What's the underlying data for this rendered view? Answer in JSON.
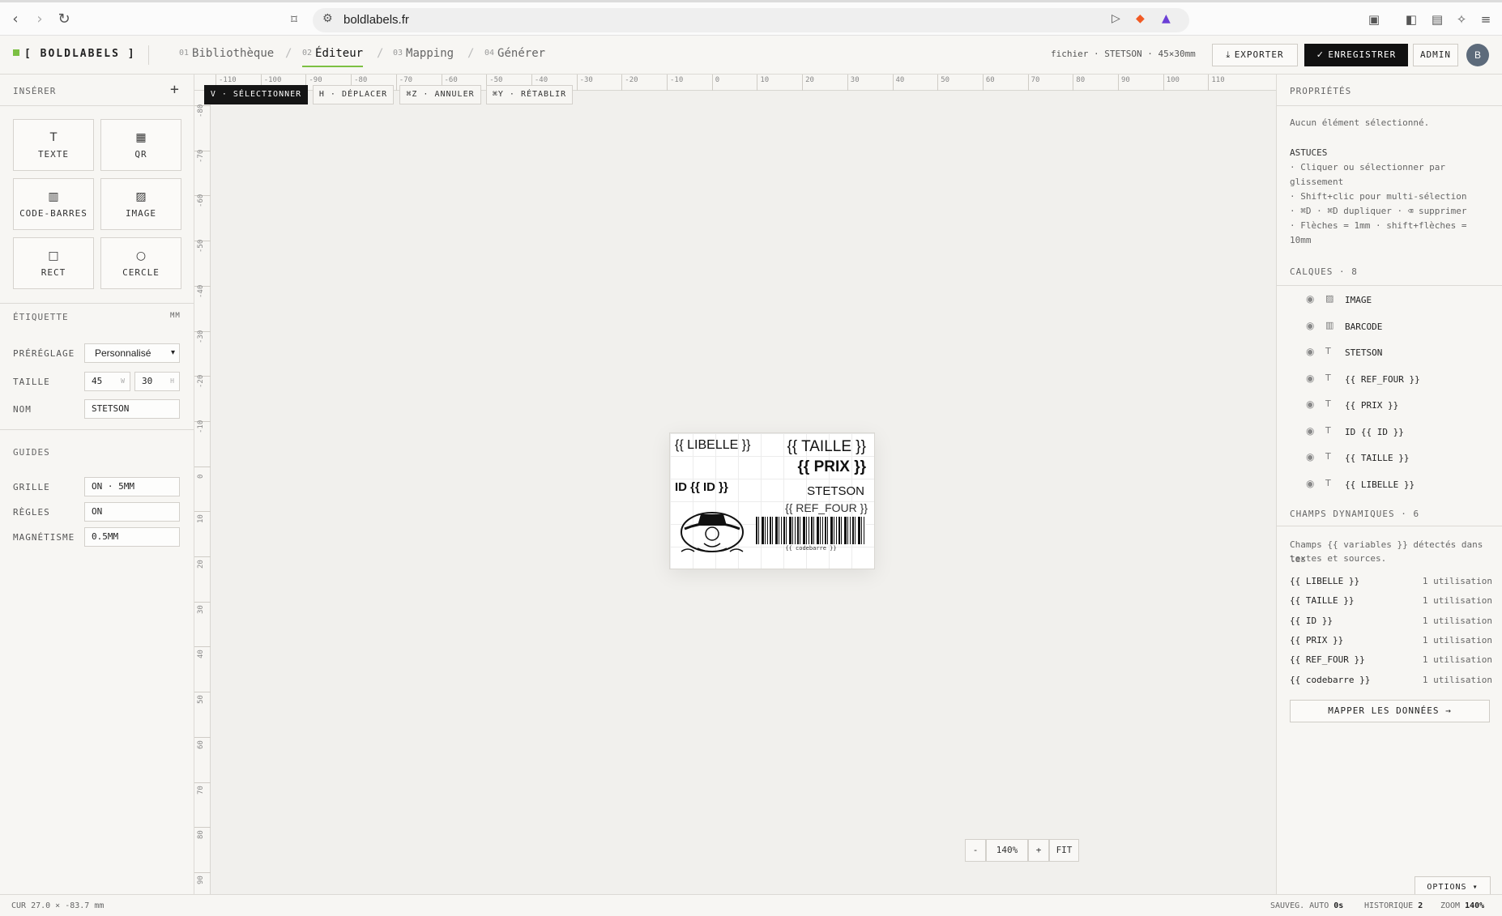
{
  "browser": {
    "url": "boldlabels.fr"
  },
  "header": {
    "brand": "[ BOLDLABELS ]",
    "steps": [
      {
        "num": "01",
        "label": "Bibliothèque"
      },
      {
        "num": "02",
        "label": "Éditeur"
      },
      {
        "num": "03",
        "label": "Mapping"
      },
      {
        "num": "04",
        "label": "Générer"
      }
    ],
    "file_info": "fichier · STETSON · 45×30mm",
    "export_label": "EXPORTER",
    "save_label": "ENREGISTRER",
    "admin_label": "ADMIN",
    "avatar_initial": "B"
  },
  "left": {
    "insert_title": "INSÉRER",
    "add_symbol": "+",
    "tools": [
      {
        "label": "TEXTE",
        "icon": "text-icon"
      },
      {
        "label": "QR",
        "icon": "qr-icon"
      },
      {
        "label": "CODE-BARRES",
        "icon": "barcode-icon"
      },
      {
        "label": "IMAGE",
        "icon": "image-icon"
      },
      {
        "label": "RECT",
        "icon": "rect-icon"
      },
      {
        "label": "CERCLE",
        "icon": "circle-icon"
      }
    ],
    "label_title": "ÉTIQUETTE",
    "label_unit": "MM",
    "preset_label": "PRÉRÉGLAGE",
    "preset_value": "Personnalisé",
    "size_label": "TAILLE",
    "width_value": "45",
    "width_unit": "W",
    "height_value": "30",
    "height_unit": "H",
    "name_label": "NOM",
    "name_value": "STETSON",
    "guides_title": "GUIDES",
    "grid_label": "GRILLE",
    "grid_value": "ON · 5MM",
    "rulers_label": "RÈGLES",
    "rulers_value": "ON",
    "snap_label": "MAGNÉTISME",
    "snap_value": "0.5MM"
  },
  "toolbar": {
    "select": "V · SÉLECTIONNER",
    "move": "H · DÉPLACER",
    "undo": "⌘Z · ANNULER",
    "redo": "⌘Y · RÉTABLIR"
  },
  "rulers": {
    "h": [
      "-110",
      "-100",
      "-90",
      "-80",
      "-70",
      "-60",
      "-50",
      "-40",
      "-30",
      "-20",
      "-10",
      "0",
      "10",
      "20",
      "30",
      "40",
      "50",
      "60",
      "70",
      "80",
      "90",
      "100",
      "110"
    ],
    "v": [
      "-80",
      "-70",
      "-60",
      "-50",
      "-40",
      "-30",
      "-20",
      "-10",
      "0",
      "10",
      "20",
      "30",
      "40",
      "50",
      "60",
      "70",
      "80",
      "90"
    ]
  },
  "label": {
    "libelle": "{{ LIBELLE }}",
    "taille": "{{ TAILLE }}",
    "prix": "{{ PRIX }}",
    "id": "ID {{ ID }}",
    "stetson": "STETSON",
    "ref_four": "{{ REF_FOUR }}",
    "codebarre": "{{ codebarre }}"
  },
  "zoom": {
    "minus": "-",
    "level": "140%",
    "plus": "+",
    "fit": "FIT"
  },
  "right": {
    "properties_title": "PROPRIÉTÉS",
    "no_selection": "Aucun élément sélectionné.",
    "tips_title": "ASTUCES",
    "tips": [
      "· Cliquer ou sélectionner par",
      "glissement",
      "· Shift+clic pour multi-sélection",
      "· ⌘D · ⌘D dupliquer · ⌫ supprimer",
      "· Flèches = 1mm · shift+flèches =",
      "10mm"
    ],
    "layers_title": "CALQUES · 8",
    "layers": [
      {
        "name": "IMAGE",
        "type": "image-icon"
      },
      {
        "name": "BARCODE",
        "type": "barcode-icon"
      },
      {
        "name": "STETSON",
        "type": "text-icon"
      },
      {
        "name": "{{ REF_FOUR }}",
        "type": "text-icon"
      },
      {
        "name": "{{ PRIX }}",
        "type": "text-icon"
      },
      {
        "name": "ID {{ ID }}",
        "type": "text-icon"
      },
      {
        "name": "{{ TAILLE }}",
        "type": "text-icon"
      },
      {
        "name": "{{ LIBELLE }}",
        "type": "text-icon"
      }
    ],
    "fields_title": "CHAMPS DYNAMIQUES · 6",
    "fields_desc_1": "Champs {{ variables }} détectés dans les",
    "fields_desc_2": "textes et sources.",
    "fields": [
      {
        "name": "{{ LIBELLE }}",
        "count": "1 utilisation"
      },
      {
        "name": "{{ TAILLE }}",
        "count": "1 utilisation"
      },
      {
        "name": "{{ ID }}",
        "count": "1 utilisation"
      },
      {
        "name": "{{ PRIX }}",
        "count": "1 utilisation"
      },
      {
        "name": "{{ REF_FOUR }}",
        "count": "1 utilisation"
      },
      {
        "name": "{{ codebarre }}",
        "count": "1 utilisation"
      }
    ],
    "map_button": "MAPPER LES DONNÉES →",
    "options_button": "OPTIONS ▾"
  },
  "status": {
    "cursor": "CUR 27.0 × -83.7 mm",
    "autosave_label": "SAUVEG. AUTO",
    "autosave_value": "0s",
    "history_label": "HISTORIQUE",
    "history_value": "2",
    "zoom_label": "ZOOM",
    "zoom_value": "140%"
  },
  "colors": {
    "accent": "#7cc043",
    "dark": "#111111"
  }
}
